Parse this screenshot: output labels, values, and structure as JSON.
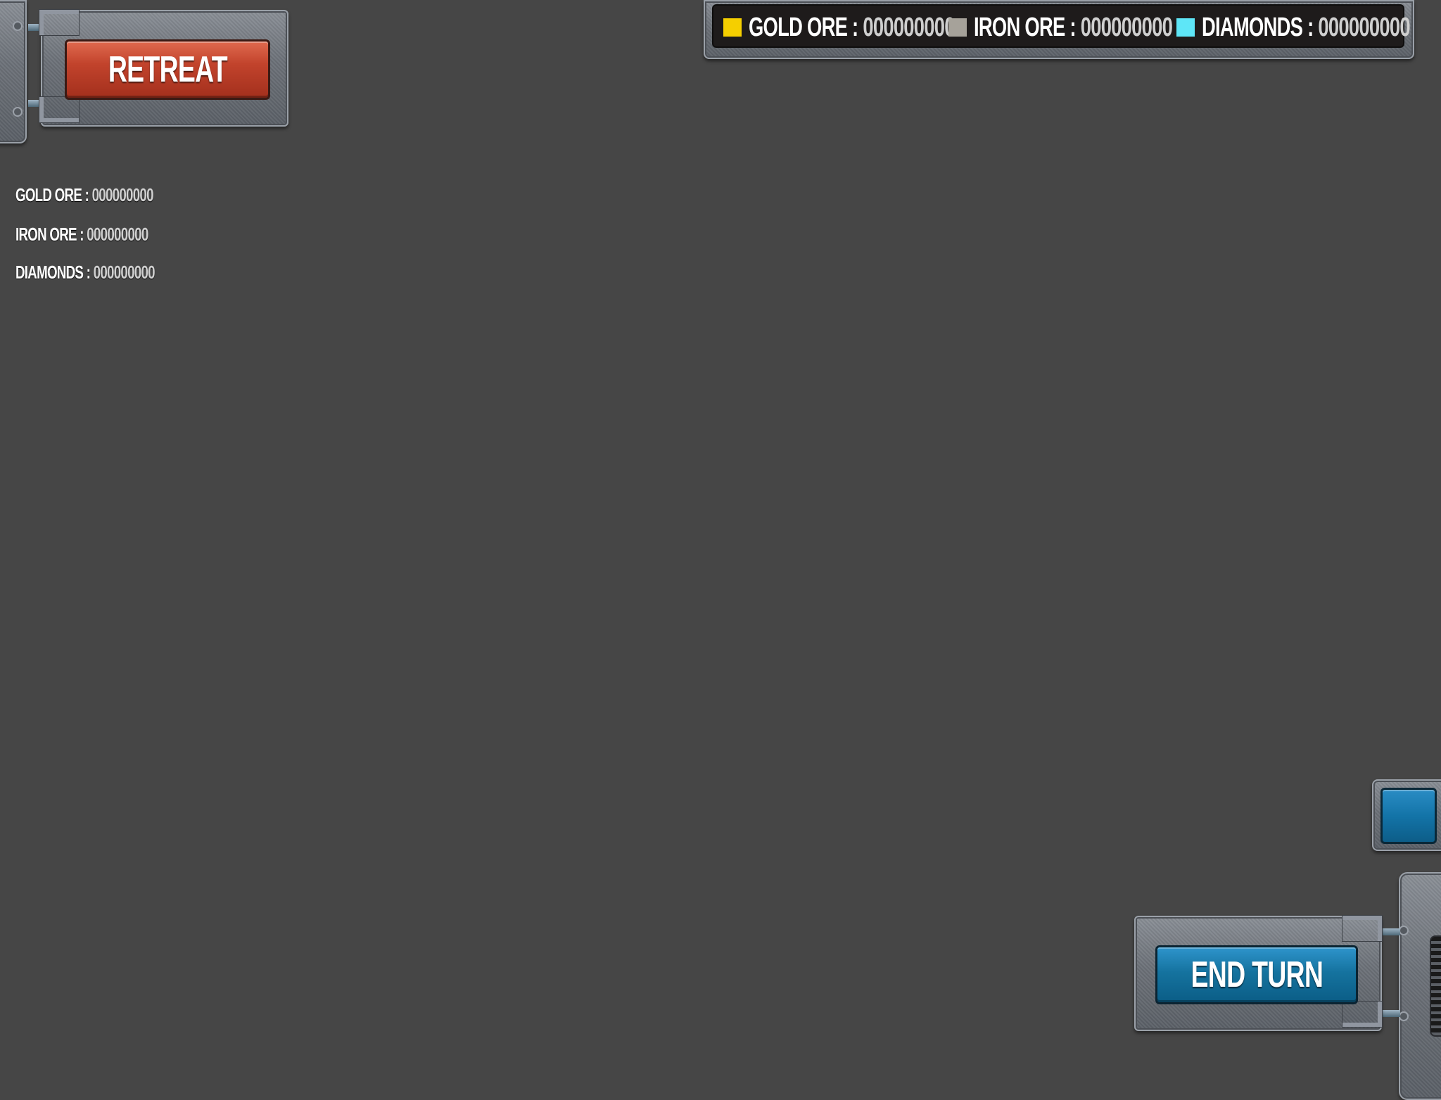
{
  "top_bar": {
    "resources": [
      {
        "label": "GOLD ORE :",
        "value": "000000000",
        "color": "#f5cf00",
        "icon": "gold-ore-swatch-icon"
      },
      {
        "label": "IRON ORE :",
        "value": "000000000",
        "color": "#a6a29a",
        "icon": "iron-ore-swatch-icon"
      },
      {
        "label": "DIAMONDS :",
        "value": "000000000",
        "color": "#5ee6f7",
        "icon": "diamonds-swatch-icon"
      }
    ]
  },
  "left_stats": [
    {
      "label": "GOLD ORE :",
      "value": "000000000"
    },
    {
      "label": "IRON ORE :",
      "value": "000000000"
    },
    {
      "label": "DIAMONDS :",
      "value": "000000000"
    }
  ],
  "buttons": {
    "retreat": "RETREAT",
    "end_turn": "END TURN"
  },
  "colors": {
    "background": "#464646",
    "retreat_button": "#c2432c",
    "end_turn_button": "#15739f"
  }
}
